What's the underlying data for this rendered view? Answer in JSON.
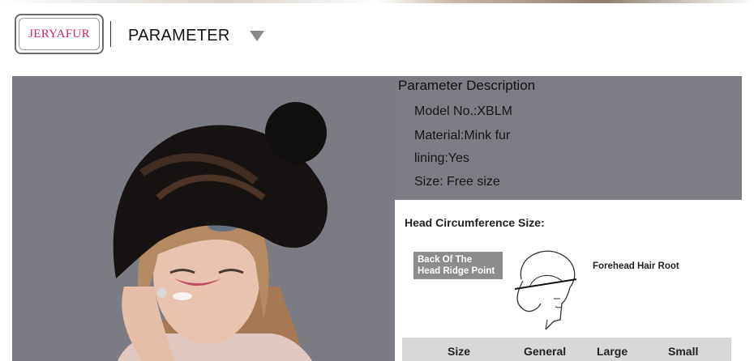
{
  "brand": {
    "logo_text": "JERYAFUR"
  },
  "header": {
    "title": "PARAMETER",
    "dropdown_icon": "triangle-down-icon"
  },
  "parameters": {
    "heading": "Parameter Description",
    "lines": [
      "Model No.:XBLM",
      "Material:Mink fur",
      "lining:Yes",
      "Size: Free size"
    ]
  },
  "size_card": {
    "heading": "Head Circumference Size:",
    "ridge_label_line1": "Back Of The",
    "ridge_label_line2": "Head Ridge Point",
    "forehead_label": "Forehead Hair Root",
    "columns": [
      "Size",
      "General",
      "Large",
      "Small"
    ]
  },
  "colors": {
    "logo_text": "#d6246a",
    "panel_bg": "#7d7d85",
    "table_header_bg": "#d8d8d8",
    "ridge_label_bg": "#8c8c8c"
  }
}
